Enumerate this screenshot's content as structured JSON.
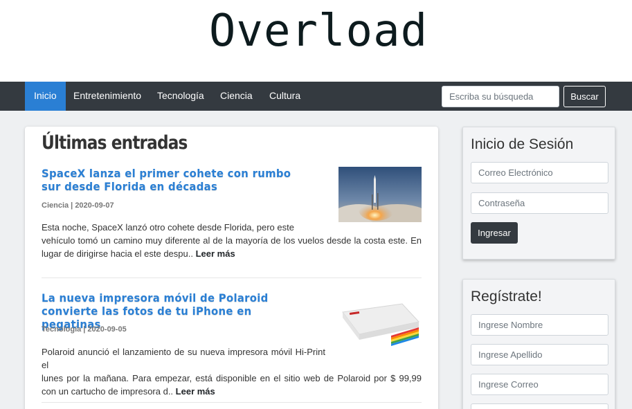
{
  "site": {
    "logo": "Overload"
  },
  "nav": {
    "items": [
      {
        "label": "Inicio",
        "active": true
      },
      {
        "label": "Entretenimiento"
      },
      {
        "label": "Tecnología"
      },
      {
        "label": "Ciencia"
      },
      {
        "label": "Cultura"
      }
    ],
    "search_placeholder": "Escriba su búsqueda",
    "search_button": "Buscar"
  },
  "main": {
    "title": "Últimas entradas",
    "posts": [
      {
        "title": "SpaceX lanza el primer cohete con rumbo sur desde Florida en décadas",
        "meta": "Ciencia | 2020-09-07",
        "excerpt_line1": "Esta noche, SpaceX lanzó otro cohete desde Florida, pero este",
        "excerpt_rest": "vehículo tomó un camino muy diferente al de la mayoría de los vuelos desde la costa este. En lugar de dirigirse hacia el este despu.. ",
        "read_more": "Leer más",
        "thumb": "rocket-launch-image"
      },
      {
        "title": "La nueva impresora móvil de Polaroid convierte las fotos de tu iPhone en pegatinas",
        "meta": "Tecnología | 2020-09-05",
        "excerpt_line1": "Polaroid anunció el lanzamiento de su nueva impresora móvil Hi-Print el",
        "excerpt_rest": "lunes por la mañana. Para empezar, está disponible en el sitio web de Polaroid por $ 99,99 con un cartucho de impresora d.. ",
        "read_more": "Leer más",
        "thumb": "polaroid-printer-image"
      }
    ]
  },
  "login": {
    "title": "Inicio de Sesión",
    "email_placeholder": "Correo Electrónico",
    "password_placeholder": "Contraseña",
    "submit": "Ingresar"
  },
  "register": {
    "title": "Regístrate!",
    "name_placeholder": "Ingrese Nombre",
    "lastname_placeholder": "Ingrese Apellido",
    "email_placeholder": "Ingrese Correo"
  },
  "colors": {
    "nav_bg": "#343a40",
    "accent": "#2a7fd4",
    "page_bg": "#eef0f2"
  }
}
